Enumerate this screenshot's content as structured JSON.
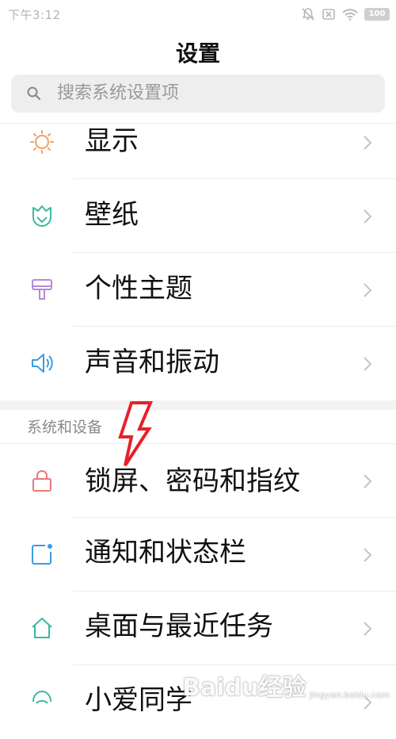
{
  "status_bar": {
    "time": "下午3:12",
    "battery": "100"
  },
  "header": {
    "title": "设置"
  },
  "search": {
    "placeholder": "搜索系统设置项"
  },
  "sections": [
    {
      "header": "",
      "items": [
        {
          "label": "显示",
          "icon": "sun-icon",
          "color": "#f0a066"
        },
        {
          "label": "壁纸",
          "icon": "tulip-icon",
          "color": "#3db8a0"
        },
        {
          "label": "个性主题",
          "icon": "brush-icon",
          "color": "#b48ad8"
        },
        {
          "label": "声音和振动",
          "icon": "speaker-icon",
          "color": "#3b9be0"
        }
      ]
    },
    {
      "header": "系统和设备",
      "items": [
        {
          "label": "锁屏、密码和指纹",
          "icon": "lock-icon",
          "color": "#e57a7a"
        },
        {
          "label": "通知和状态栏",
          "icon": "notification-icon",
          "color": "#3b9be0"
        },
        {
          "label": "桌面与最近任务",
          "icon": "home-icon",
          "color": "#3db8a0"
        },
        {
          "label": "小爱同学",
          "icon": "assistant-icon",
          "color": "#3db8a0"
        }
      ]
    }
  ],
  "annotation": {
    "color": "#e8202a"
  },
  "watermark": {
    "main": "Baidu经验",
    "sub": "jingyan.baidu.com"
  }
}
